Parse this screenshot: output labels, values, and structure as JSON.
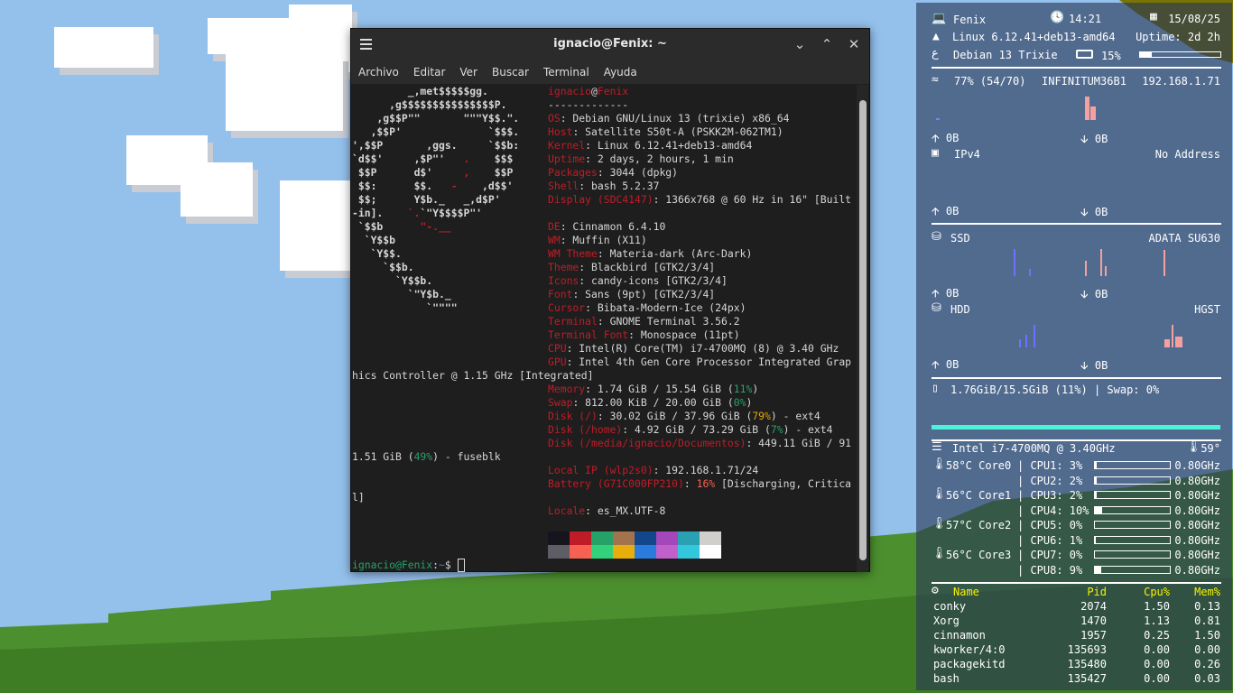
{
  "terminal": {
    "title": "ignacio@Fenix: ~",
    "menu": [
      "Archivo",
      "Editar",
      "Ver",
      "Buscar",
      "Terminal",
      "Ayuda"
    ],
    "art": [
      [
        [
          "         _,met$$$$$gg.",
          "w"
        ]
      ],
      [
        [
          "      ,g$$$$$$$$$$$$$$$P.",
          "w"
        ]
      ],
      [
        [
          "    ,g$$P\"\"       \"\"\"Y$$.\".",
          "w"
        ]
      ],
      [
        [
          "   ,$$P'              `$$$.",
          "w"
        ]
      ],
      [
        [
          "',$$P       ,ggs.     `$$b:",
          "w"
        ]
      ],
      [
        [
          "`d$$'     ,$P\"'   ",
          "w"
        ],
        [
          ".",
          "r"
        ],
        [
          "    $$$",
          "w"
        ]
      ],
      [
        [
          " $$P      d$'     ",
          "w"
        ],
        [
          ",",
          "r"
        ],
        [
          "    $$P",
          "w"
        ]
      ],
      [
        [
          " $$:      $$.   ",
          "w"
        ],
        [
          "-",
          "r"
        ],
        [
          "    ,d$$'",
          "w"
        ]
      ],
      [
        [
          " $$;      Y$b._   _,d$P'",
          "w"
        ]
      ],
      [
        [
          "-in].    ",
          "w"
        ],
        [
          "`.",
          "r"
        ],
        [
          "`\"Y$$$$P\"'",
          "w"
        ]
      ],
      [
        [
          " `$$b      ",
          "w"
        ],
        [
          "\"-.__",
          "r"
        ]
      ],
      [
        [
          "  `Y$$b",
          "w"
        ]
      ],
      [
        [
          "   `Y$$.",
          "w"
        ]
      ],
      [
        [
          "     `$$b.",
          "w"
        ]
      ],
      [
        [
          "       `Y$$b.",
          "w"
        ]
      ],
      [
        [
          "         `\"Y$b._",
          "w"
        ]
      ],
      [
        [
          "            `\"\"\"\"",
          "w"
        ]
      ]
    ],
    "info": [
      {
        "s": [
          [
            "ignacio",
            "r"
          ],
          [
            "@",
            "w"
          ],
          [
            "Fenix",
            "r"
          ]
        ]
      },
      {
        "s": [
          [
            "-------------",
            "w"
          ]
        ]
      },
      {
        "s": [
          [
            "OS",
            "r"
          ],
          [
            ": Debian GNU/Linux 13 (trixie) x86_64",
            "w"
          ]
        ]
      },
      {
        "s": [
          [
            "Host",
            "r"
          ],
          [
            ": Satellite S50t-A (PSKK2M-062TM1)",
            "w"
          ]
        ]
      },
      {
        "s": [
          [
            "Kernel",
            "r"
          ],
          [
            ": Linux 6.12.41+deb13-amd64",
            "w"
          ]
        ]
      },
      {
        "s": [
          [
            "Uptime",
            "r"
          ],
          [
            ": 2 days, 2 hours, 1 min",
            "w"
          ]
        ]
      },
      {
        "s": [
          [
            "Packages",
            "r"
          ],
          [
            ": 3044 (dpkg)",
            "w"
          ]
        ]
      },
      {
        "s": [
          [
            "Shell",
            "r"
          ],
          [
            ": bash 5.2.37",
            "w"
          ]
        ]
      },
      {
        "s": [
          [
            "Display (SDC4147)",
            "r"
          ],
          [
            ": 1366x768 @ 60 Hz in 16\" [Built",
            "w"
          ]
        ]
      },
      {
        "s": []
      },
      {
        "s": [
          [
            "DE",
            "r"
          ],
          [
            ": Cinnamon 6.4.10",
            "w"
          ]
        ]
      },
      {
        "s": [
          [
            "WM",
            "r"
          ],
          [
            ": Muffin (X11)",
            "w"
          ]
        ]
      },
      {
        "s": [
          [
            "WM Theme",
            "r"
          ],
          [
            ": Materia-dark (Arc-Dark)",
            "w"
          ]
        ]
      },
      {
        "s": [
          [
            "Theme",
            "r"
          ],
          [
            ": Blackbird [GTK2/3/4]",
            "w"
          ]
        ]
      },
      {
        "s": [
          [
            "Icons",
            "r"
          ],
          [
            ": candy-icons [GTK2/3/4]",
            "w"
          ]
        ]
      },
      {
        "s": [
          [
            "Font",
            "r"
          ],
          [
            ": Sans (9pt) [GTK2/3/4]",
            "w"
          ]
        ]
      },
      {
        "s": [
          [
            "Cursor",
            "r"
          ],
          [
            ": Bibata-Modern-Ice (24px)",
            "w"
          ]
        ]
      },
      {
        "s": [
          [
            "Terminal",
            "r"
          ],
          [
            ": GNOME Terminal 3.56.2",
            "w"
          ]
        ]
      },
      {
        "s": [
          [
            "Terminal Font",
            "r"
          ],
          [
            ": Monospace (11pt)",
            "w"
          ]
        ]
      },
      {
        "s": [
          [
            "CPU",
            "r"
          ],
          [
            ": Intel(R) Core(TM) i7-4700MQ (8) @ 3.40 GHz",
            "w"
          ]
        ]
      },
      {
        "s": [
          [
            "GPU",
            "r"
          ],
          [
            ": Intel 4th Gen Core Processor Integrated Grap",
            "w"
          ]
        ]
      },
      {
        "cont": true,
        "s": [
          [
            "hics Controller @ 1.15 GHz [Integrated]",
            "w"
          ]
        ]
      },
      {
        "s": [
          [
            "Memory",
            "r"
          ],
          [
            ": 1.74 GiB / 15.54 GiB (",
            "w"
          ],
          [
            "11%",
            "g"
          ],
          [
            ")",
            "w"
          ]
        ]
      },
      {
        "s": [
          [
            "Swap",
            "r"
          ],
          [
            ": 812.00 KiB / 20.00 GiB (",
            "w"
          ],
          [
            "0%",
            "g"
          ],
          [
            ")",
            "w"
          ]
        ]
      },
      {
        "s": [
          [
            "Disk (/)",
            "r"
          ],
          [
            ": 30.02 GiB / 37.96 GiB (",
            "w"
          ],
          [
            "79%",
            "y"
          ],
          [
            ") - ext4",
            "w"
          ]
        ]
      },
      {
        "s": [
          [
            "Disk (/home)",
            "r"
          ],
          [
            ": 4.92 GiB / 73.29 GiB (",
            "w"
          ],
          [
            "7%",
            "g"
          ],
          [
            ") - ext4",
            "w"
          ]
        ]
      },
      {
        "s": [
          [
            "Disk (/media/ignacio/Documentos)",
            "r"
          ],
          [
            ": 449.11 GiB / 91",
            "w"
          ]
        ]
      },
      {
        "cont": true,
        "s": [
          [
            "1.51 GiB (",
            "w"
          ],
          [
            "49%",
            "g"
          ],
          [
            ") - fuseblk",
            "w"
          ]
        ]
      },
      {
        "s": [
          [
            "Local IP (wlp2s0)",
            "r"
          ],
          [
            ": 192.168.1.71/24",
            "w"
          ]
        ]
      },
      {
        "s": [
          [
            "Battery (G71C000FP210)",
            "r"
          ],
          [
            ": ",
            "w"
          ],
          [
            "16%",
            "o"
          ],
          [
            " [Discharging, Critica",
            "w"
          ]
        ]
      },
      {
        "cont": true,
        "s": [
          [
            "l]",
            "w"
          ]
        ]
      },
      {
        "s": [
          [
            "Locale",
            "r"
          ],
          [
            ": es_MX.UTF-8",
            "w"
          ]
        ]
      },
      {
        "s": []
      }
    ],
    "palette": [
      [
        "#16141d",
        "#c01c28",
        "#26a269",
        "#a2734c",
        "#12488b",
        "#a347ba",
        "#2aa1b3",
        "#d0cfcc"
      ],
      [
        "#5e5c64",
        "#f66151",
        "#33d17a",
        "#e9ad0c",
        "#2a7bde",
        "#c061cb",
        "#33c7de",
        "#ffffff"
      ]
    ],
    "prompt": {
      "user": "ignacio@Fenix",
      "sep": ":",
      "path": "~",
      "sym": "$ "
    }
  },
  "conky": {
    "host": "Fenix",
    "time": "14:21",
    "date": "15/08/25",
    "kernel": "Linux 6.12.41+deb13-amd64",
    "uptime": "Uptime: 2d 2h",
    "distro": "Debian 13 Trixie",
    "battery": "15%",
    "battery_pct": 15,
    "wifi": "77% (54/70)",
    "ssid": "INFINITUM36B1",
    "ip": "192.168.1.71",
    "wifi_up": "0B",
    "wifi_down": "0B",
    "eth": "IPv4",
    "eth_addr": "No Address",
    "eth_up": "0B",
    "eth_down": "0B",
    "ssd": "SSD",
    "ssd_model": "ADATA SU630",
    "ssd_up": "0B",
    "ssd_down": "0B",
    "hdd": "HDD",
    "hdd_model": "HGST",
    "hdd_up": "0B",
    "hdd_down": "0B",
    "mem": "1.76GiB/15.5GiB (11%) | Swap: 0%",
    "mem_pct": 11,
    "cpu": "Intel i7-4700MQ @ 3.40GHz",
    "cpu_temp": "59°",
    "cores": [
      "58°C Core0",
      "56°C Core1",
      "57°C Core2",
      "56°C Core3"
    ],
    "cpus": [
      {
        "label": "| CPU1: 3%",
        "pct": 3,
        "freq": "0.80GHz"
      },
      {
        "label": "| CPU2: 2%",
        "pct": 2,
        "freq": "0.80GHz"
      },
      {
        "label": "| CPU3: 2%",
        "pct": 2,
        "freq": "0.80GHz"
      },
      {
        "label": "| CPU4: 10%",
        "pct": 10,
        "freq": "0.80GHz"
      },
      {
        "label": "| CPU5: 0%",
        "pct": 0,
        "freq": "0.80GHz"
      },
      {
        "label": "| CPU6: 1%",
        "pct": 1,
        "freq": "0.80GHz"
      },
      {
        "label": "| CPU7: 0%",
        "pct": 0,
        "freq": "0.80GHz"
      },
      {
        "label": "| CPU8: 9%",
        "pct": 9,
        "freq": "0.80GHz"
      }
    ],
    "proc_headers": [
      "Name",
      "Pid",
      "Cpu%",
      "Mem%"
    ],
    "procs": [
      [
        "conky",
        "2074",
        "1.50",
        "0.13"
      ],
      [
        "Xorg",
        "1470",
        "1.13",
        "0.81"
      ],
      [
        "cinnamon",
        "1957",
        "0.25",
        "1.50"
      ],
      [
        "kworker/4:0",
        "135693",
        "0.00",
        "0.00"
      ],
      [
        "packagekitd",
        "135480",
        "0.00",
        "0.26"
      ],
      [
        "bash",
        "135427",
        "0.00",
        "0.03"
      ]
    ]
  }
}
